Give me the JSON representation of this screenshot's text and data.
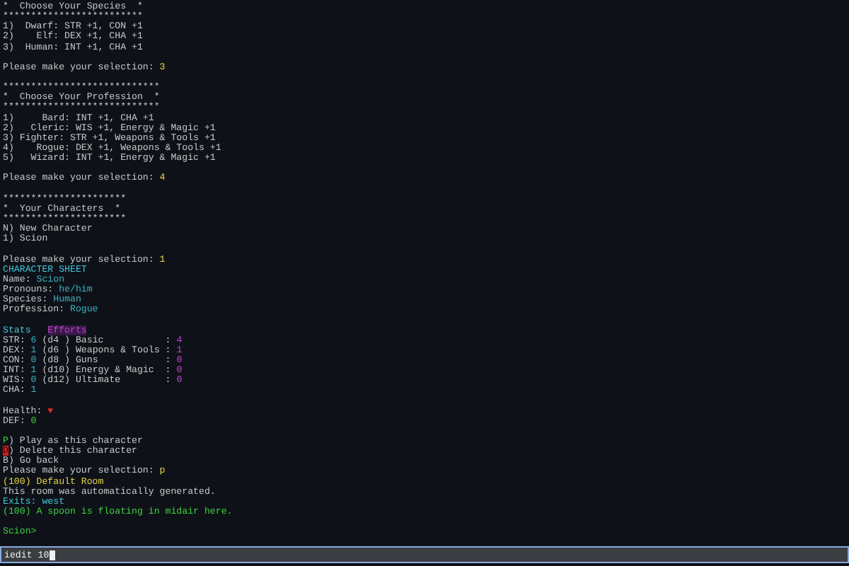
{
  "terminal": {
    "lines": [
      {
        "kind": "text",
        "segments": [
          {
            "kind": "text",
            "text": "*  Choose Your Species  *"
          }
        ]
      },
      {
        "kind": "text",
        "segments": [
          {
            "kind": "text",
            "text": "*************************"
          }
        ]
      },
      {
        "kind": "text",
        "segments": [
          {
            "kind": "text",
            "text": "1)  Dwarf: STR +1, CON +1"
          }
        ]
      },
      {
        "kind": "text",
        "segments": [
          {
            "kind": "text",
            "text": "2)    Elf: DEX +1, CHA +1"
          }
        ]
      },
      {
        "kind": "text",
        "segments": [
          {
            "kind": "text",
            "text": "3)  Human: INT +1, CHA +1"
          }
        ]
      },
      {
        "kind": "blank"
      },
      {
        "kind": "text",
        "segments": [
          {
            "kind": "text",
            "text": "Please make your selection: "
          },
          {
            "kind": "input",
            "text": "3"
          }
        ]
      },
      {
        "kind": "blank"
      },
      {
        "kind": "text",
        "segments": [
          {
            "kind": "text",
            "text": "****************************"
          }
        ]
      },
      {
        "kind": "text",
        "segments": [
          {
            "kind": "text",
            "text": "*  Choose Your Profession  *"
          }
        ]
      },
      {
        "kind": "text",
        "segments": [
          {
            "kind": "text",
            "text": "****************************"
          }
        ]
      },
      {
        "kind": "text",
        "segments": [
          {
            "kind": "text",
            "text": "1)     Bard: INT +1, CHA +1"
          }
        ]
      },
      {
        "kind": "text",
        "segments": [
          {
            "kind": "text",
            "text": "2)   Cleric: WIS +1, Energy & Magic +1"
          }
        ]
      },
      {
        "kind": "text",
        "segments": [
          {
            "kind": "text",
            "text": "3) Fighter: STR +1, Weapons & Tools +1"
          }
        ]
      },
      {
        "kind": "text",
        "segments": [
          {
            "kind": "text",
            "text": "4)    Rogue: DEX +1, Weapons & Tools +1"
          }
        ]
      },
      {
        "kind": "text",
        "segments": [
          {
            "kind": "text",
            "text": "5)   Wizard: INT +1, Energy & Magic +1"
          }
        ]
      },
      {
        "kind": "blank"
      },
      {
        "kind": "text",
        "segments": [
          {
            "kind": "text",
            "text": "Please make your selection: "
          },
          {
            "kind": "input",
            "text": "4"
          }
        ]
      },
      {
        "kind": "blank"
      },
      {
        "kind": "text",
        "segments": [
          {
            "kind": "text",
            "text": "**********************"
          }
        ]
      },
      {
        "kind": "text",
        "segments": [
          {
            "kind": "text",
            "text": "*  Your Characters  *"
          }
        ]
      },
      {
        "kind": "text",
        "segments": [
          {
            "kind": "text",
            "text": "**********************"
          }
        ]
      },
      {
        "kind": "text",
        "segments": [
          {
            "kind": "text",
            "text": "N) New Character"
          }
        ]
      },
      {
        "kind": "text",
        "segments": [
          {
            "kind": "text",
            "text": "1) Scion"
          }
        ]
      },
      {
        "kind": "blank"
      },
      {
        "kind": "text",
        "segments": [
          {
            "kind": "text",
            "text": "Please make your selection: "
          },
          {
            "kind": "input",
            "text": "1"
          }
        ]
      },
      {
        "kind": "text",
        "segments": [
          {
            "kind": "heading",
            "text": "CHARACTER SHEET"
          }
        ]
      },
      {
        "kind": "text",
        "segments": [
          {
            "kind": "text",
            "text": "Name: "
          },
          {
            "kind": "value",
            "text": "Scion"
          }
        ]
      },
      {
        "kind": "text",
        "segments": [
          {
            "kind": "text",
            "text": "Pronouns: "
          },
          {
            "kind": "value",
            "text": "he/him"
          }
        ]
      },
      {
        "kind": "text",
        "segments": [
          {
            "kind": "text",
            "text": "Species: "
          },
          {
            "kind": "value",
            "text": "Human"
          }
        ]
      },
      {
        "kind": "text",
        "segments": [
          {
            "kind": "text",
            "text": "Profession: "
          },
          {
            "kind": "value",
            "text": "Rogue"
          }
        ]
      },
      {
        "kind": "blank"
      },
      {
        "kind": "text",
        "segments": [
          {
            "kind": "heading",
            "text": "Stats"
          },
          {
            "kind": "effort-heading",
            "text": "Efforts"
          }
        ]
      },
      {
        "kind": "text",
        "segments": [
          {
            "kind": "text",
            "text": "STR: "
          },
          {
            "kind": "value",
            "text": "6"
          },
          {
            "kind": "text",
            "text": " (d4 ) Basic           : "
          },
          {
            "kind": "effort",
            "text": "4"
          }
        ]
      },
      {
        "kind": "text",
        "segments": [
          {
            "kind": "text",
            "text": "DEX: "
          },
          {
            "kind": "value",
            "text": "1"
          },
          {
            "kind": "text",
            "text": " (d6 ) Weapons & Tools : "
          },
          {
            "kind": "effort",
            "text": "1"
          }
        ]
      },
      {
        "kind": "text",
        "segments": [
          {
            "kind": "text",
            "text": "CON: "
          },
          {
            "kind": "value",
            "text": "0"
          },
          {
            "kind": "text",
            "text": " (d8 ) Guns            : "
          },
          {
            "kind": "effort",
            "text": "0"
          }
        ]
      },
      {
        "kind": "text",
        "segments": [
          {
            "kind": "text",
            "text": "INT: "
          },
          {
            "kind": "value",
            "text": "1"
          },
          {
            "kind": "text",
            "text": " (d10) Energy & Magic  : "
          },
          {
            "kind": "effort",
            "text": "0"
          }
        ]
      },
      {
        "kind": "text",
        "segments": [
          {
            "kind": "text",
            "text": "WIS: "
          },
          {
            "kind": "value",
            "text": "0"
          },
          {
            "kind": "text",
            "text": " (d12) Ultimate        : "
          },
          {
            "kind": "effort",
            "text": "0"
          }
        ]
      },
      {
        "kind": "text",
        "segments": [
          {
            "kind": "text",
            "text": "CHA: "
          },
          {
            "kind": "value",
            "text": "1"
          }
        ]
      },
      {
        "kind": "blank"
      },
      {
        "kind": "text",
        "segments": [
          {
            "kind": "text",
            "text": "Health: "
          },
          {
            "kind": "alert",
            "text": "♥"
          }
        ]
      },
      {
        "kind": "text",
        "segments": [
          {
            "kind": "text",
            "text": "DEF: "
          },
          {
            "kind": "good",
            "text": "0"
          }
        ]
      },
      {
        "kind": "blank"
      },
      {
        "kind": "text",
        "segments": [
          {
            "kind": "good",
            "text": "P"
          },
          {
            "kind": "text",
            "text": ") Play as this character"
          }
        ]
      },
      {
        "kind": "text",
        "segments": [
          {
            "kind": "danger",
            "text": "D"
          },
          {
            "kind": "text",
            "text": ") Delete this character"
          }
        ]
      },
      {
        "kind": "text",
        "segments": [
          {
            "kind": "text",
            "text": "B) Go back"
          }
        ]
      },
      {
        "kind": "text",
        "segments": [
          {
            "kind": "text",
            "text": "Please make your selection: "
          },
          {
            "kind": "input",
            "text": "p"
          }
        ]
      },
      {
        "kind": "text",
        "segments": [
          {
            "kind": "room",
            "text": "(100) Default Room"
          }
        ]
      },
      {
        "kind": "text",
        "segments": [
          {
            "kind": "text",
            "text": "This room was automatically generated."
          }
        ]
      },
      {
        "kind": "text",
        "segments": [
          {
            "kind": "exits",
            "text": "Exits: west"
          }
        ]
      },
      {
        "kind": "text",
        "segments": [
          {
            "kind": "good",
            "text": "(100) A spoon is floating in midair here."
          }
        ]
      },
      {
        "kind": "blank"
      },
      {
        "kind": "text",
        "segments": [
          {
            "kind": "good",
            "text": "Scion>"
          }
        ]
      }
    ]
  },
  "command_input": {
    "value": "iedit 10"
  }
}
